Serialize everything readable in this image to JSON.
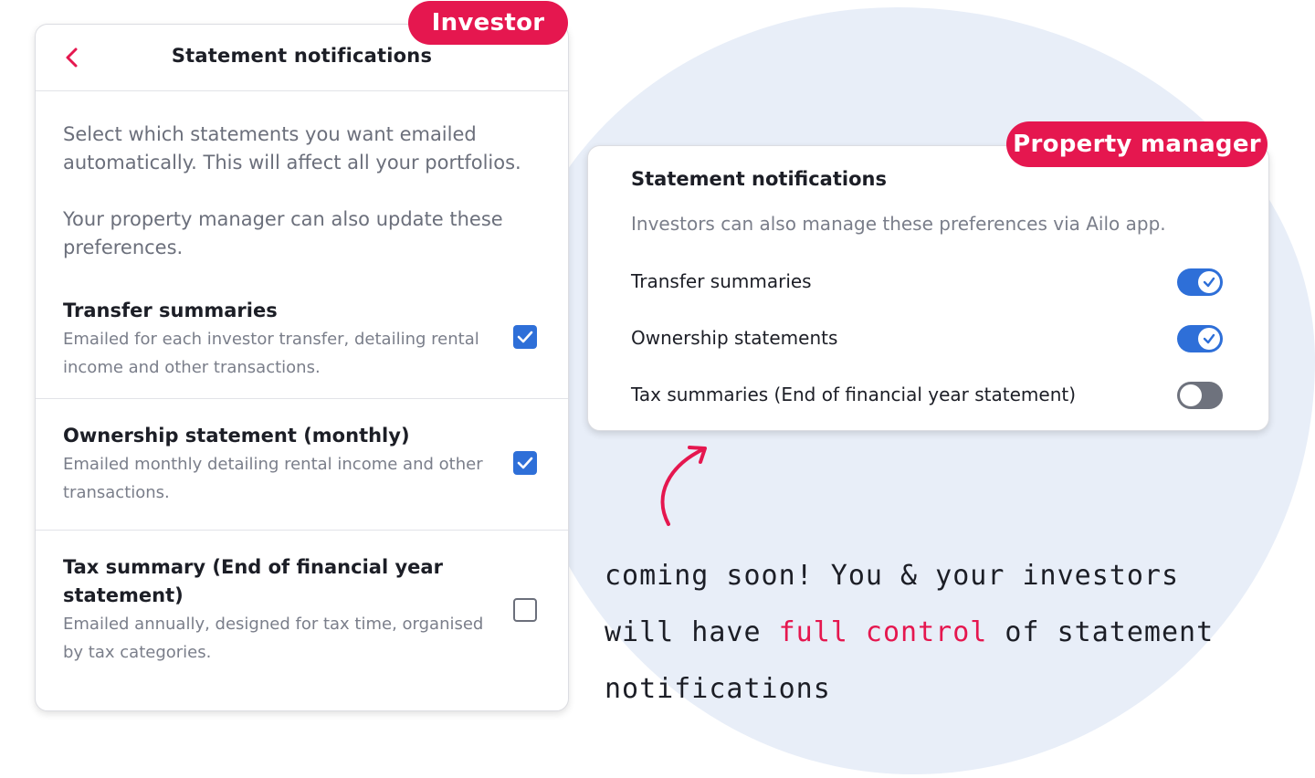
{
  "investor": {
    "tag": "Investor",
    "title": "Statement notifications",
    "intro_1": "Select which statements you want emailed automatically. This will affect all your portfolios.",
    "intro_2": "Your property manager can also update these preferences.",
    "items": [
      {
        "title": "Transfer summaries",
        "desc": "Emailed for each investor transfer, detailing rental income and other transactions.",
        "checked": true
      },
      {
        "title": "Ownership statement (monthly)",
        "desc": "Emailed monthly detailing rental income and other transactions.",
        "checked": true
      },
      {
        "title": "Tax summary (End of financial year statement)",
        "desc": "Emailed annually, designed for tax time, organised by tax categories.",
        "checked": false
      }
    ]
  },
  "pm": {
    "tag": "Property manager",
    "title": "Statement notifications",
    "subtitle": "Investors can also manage these preferences via Ailo app.",
    "items": [
      {
        "label": "Transfer summaries",
        "on": true
      },
      {
        "label": "Ownership statements",
        "on": true
      },
      {
        "label": "Tax summaries (End of financial year statement)",
        "on": false
      }
    ]
  },
  "note": {
    "part1": "coming soon! You & your investors will have ",
    "highlight": "full control",
    "part2": " of statement notifications"
  },
  "colors": {
    "accent": "#e5174f",
    "toggle_on": "#2e6fd8",
    "background_blob": "#e8eef8"
  }
}
